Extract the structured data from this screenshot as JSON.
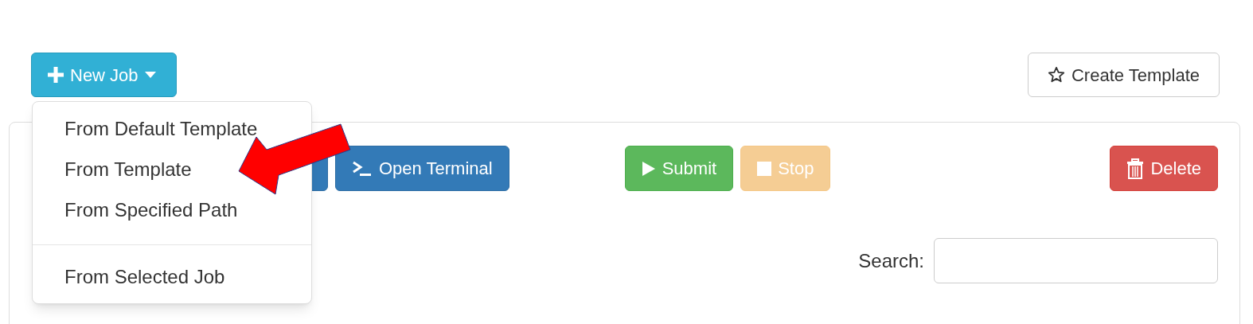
{
  "new_job_button": {
    "label": "New Job"
  },
  "create_template_button": {
    "label": "Create Template"
  },
  "toolbar": [
    {
      "kind": "primary",
      "label": "Open Terminal",
      "disabled": false
    },
    {
      "kind": "success",
      "label": "Submit",
      "disabled": false
    },
    {
      "kind": "warning",
      "label": "Stop",
      "disabled": true
    },
    {
      "kind": "danger",
      "label": "Delete",
      "disabled": false
    }
  ],
  "search": {
    "label": "Search:"
  },
  "dropdown_menu": [
    {
      "label": "From Default Template"
    },
    {
      "label": "From Template"
    },
    {
      "label": "From Specified Path"
    },
    {
      "kind": "divider"
    },
    {
      "label": "From Selected Job"
    }
  ]
}
